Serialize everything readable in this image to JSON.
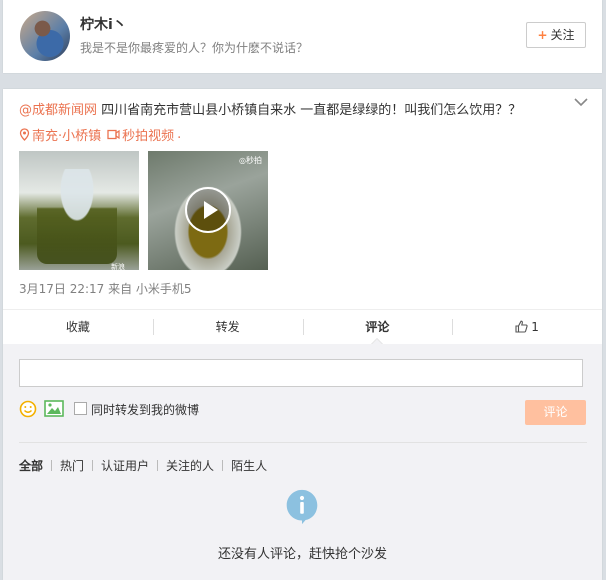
{
  "profile": {
    "name": "柠木i丶",
    "bio": "我是不是你最疼爱的人？你为什麽不说话？",
    "follow_label": "关注"
  },
  "post": {
    "mention": "@成都新闻网",
    "text": " 四川省南充市营山县小桥镇自来水 一直都是绿绿的！叫我们怎么饮用？？",
    "location": "南充·小桥镇",
    "video_link": "秒拍视频",
    "location_trail": ".",
    "meta": "3月17日 22:17 来自 小米手机5",
    "thumb1_watermark": "新浪",
    "thumb2_watermark": "◎秒拍"
  },
  "actions": {
    "favorite": "收藏",
    "repost": "转发",
    "comment": "评论",
    "like_count": "1"
  },
  "comment_box": {
    "input_value": "",
    "forward_label": "同时转发到我的微博",
    "submit_label": "评论"
  },
  "filters": [
    "全部",
    "热门",
    "认证用户",
    "关注的人",
    "陌生人"
  ],
  "empty_text": "还没有人评论，赶快抢个沙发",
  "colors": {
    "accent": "#eb7350",
    "follow_plus": "#ff8140",
    "submit_bg": "#ffc09f",
    "info_icon": "#8cc1e0"
  },
  "icons": {
    "dropdown": "chevron-down-icon",
    "location": "location-pin-icon",
    "video": "video-icon",
    "play": "play-icon",
    "like": "thumbs-up-icon",
    "emoji": "smiley-icon",
    "picture": "picture-icon",
    "info": "info-icon"
  }
}
